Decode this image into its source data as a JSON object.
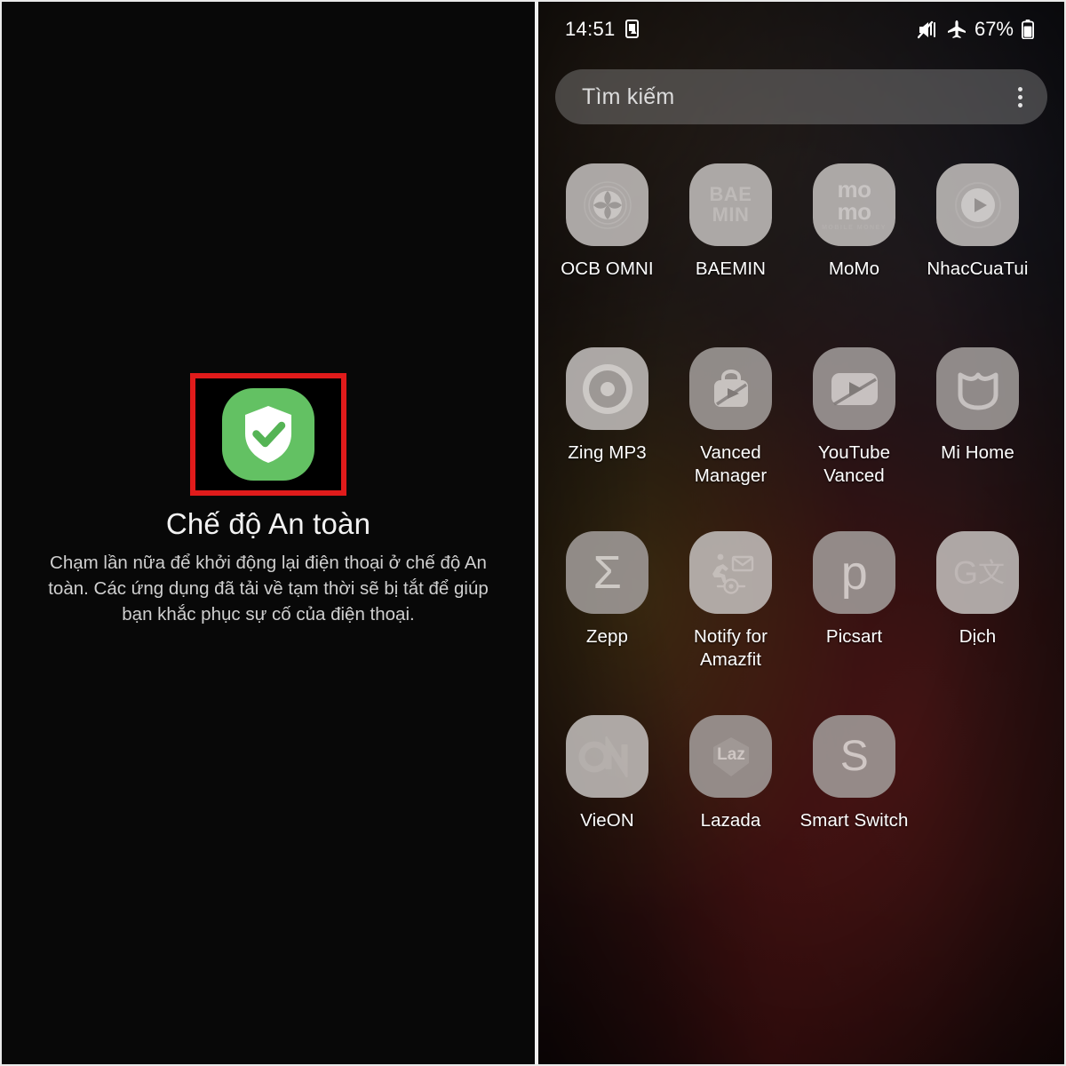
{
  "left_panel": {
    "safe_mode": {
      "icon_name": "safe-mode-shield-icon",
      "icon_color": "#63c163",
      "highlight_color": "#e01b1b",
      "title": "Chế độ An toàn",
      "description": "Chạm lần nữa để khởi động lại điện thoại ở chế độ An toàn. Các ứng dụng đã tải về tạm thời sẽ bị tắt để giúp bạn khắc phục sự cố của điện thoại."
    }
  },
  "right_panel": {
    "status_bar": {
      "time": "14:51",
      "notification_icon": "device-warning-icon",
      "mute_icon": "sound-mute-icon",
      "airplane_icon": "airplane-mode-icon",
      "battery_percent": "67%",
      "battery_icon": "battery-icon"
    },
    "search": {
      "placeholder": "Tìm kiếm",
      "value": "",
      "menu_icon": "more-options-kebab-icon"
    },
    "app_rows": [
      [
        {
          "label": "OCB OMNI",
          "icon": "ocb-omni-icon",
          "glyph": "",
          "shade": "lighter"
        },
        {
          "label": "BAEMIN",
          "icon": "baemin-icon",
          "glyph": "BAE\nMIN",
          "shade": "lighter"
        },
        {
          "label": "MoMo",
          "icon": "momo-icon",
          "glyph": "mo\nmo",
          "shade": "lighter"
        },
        {
          "label": "NhacCuaTui",
          "icon": "nhaccuatui-icon",
          "glyph": "",
          "shade": "lighter"
        }
      ],
      [
        {
          "label": "Zing MP3",
          "icon": "zing-mp3-icon",
          "glyph": "",
          "shade": "lighter"
        },
        {
          "label": "Vanced Manager",
          "icon": "vanced-manager-icon",
          "glyph": "",
          "shade": "darker"
        },
        {
          "label": "YouTube Vanced",
          "icon": "youtube-vanced-icon",
          "glyph": "",
          "shade": "darker"
        },
        {
          "label": "Mi Home",
          "icon": "mi-home-icon",
          "glyph": "",
          "shade": "darker"
        }
      ],
      [
        {
          "label": "Zepp",
          "icon": "zepp-icon",
          "glyph": "Σ",
          "shade": "darker"
        },
        {
          "label": "Notify for Amazfit",
          "icon": "notify-for-amazfit-icon",
          "glyph": "",
          "shade": "lighter"
        },
        {
          "label": "Picsart",
          "icon": "picsart-icon",
          "glyph": "p",
          "shade": "darker"
        },
        {
          "label": "Dịch",
          "icon": "google-translate-icon",
          "glyph": "",
          "shade": "lighter"
        }
      ],
      [
        {
          "label": "VieON",
          "icon": "vieon-icon",
          "glyph": "",
          "shade": "lighter"
        },
        {
          "label": "Lazada",
          "icon": "lazada-icon",
          "glyph": "Laz",
          "shade": "darker"
        },
        {
          "label": "Smart Switch",
          "icon": "smart-switch-icon",
          "glyph": "S",
          "shade": "darker"
        }
      ]
    ]
  }
}
